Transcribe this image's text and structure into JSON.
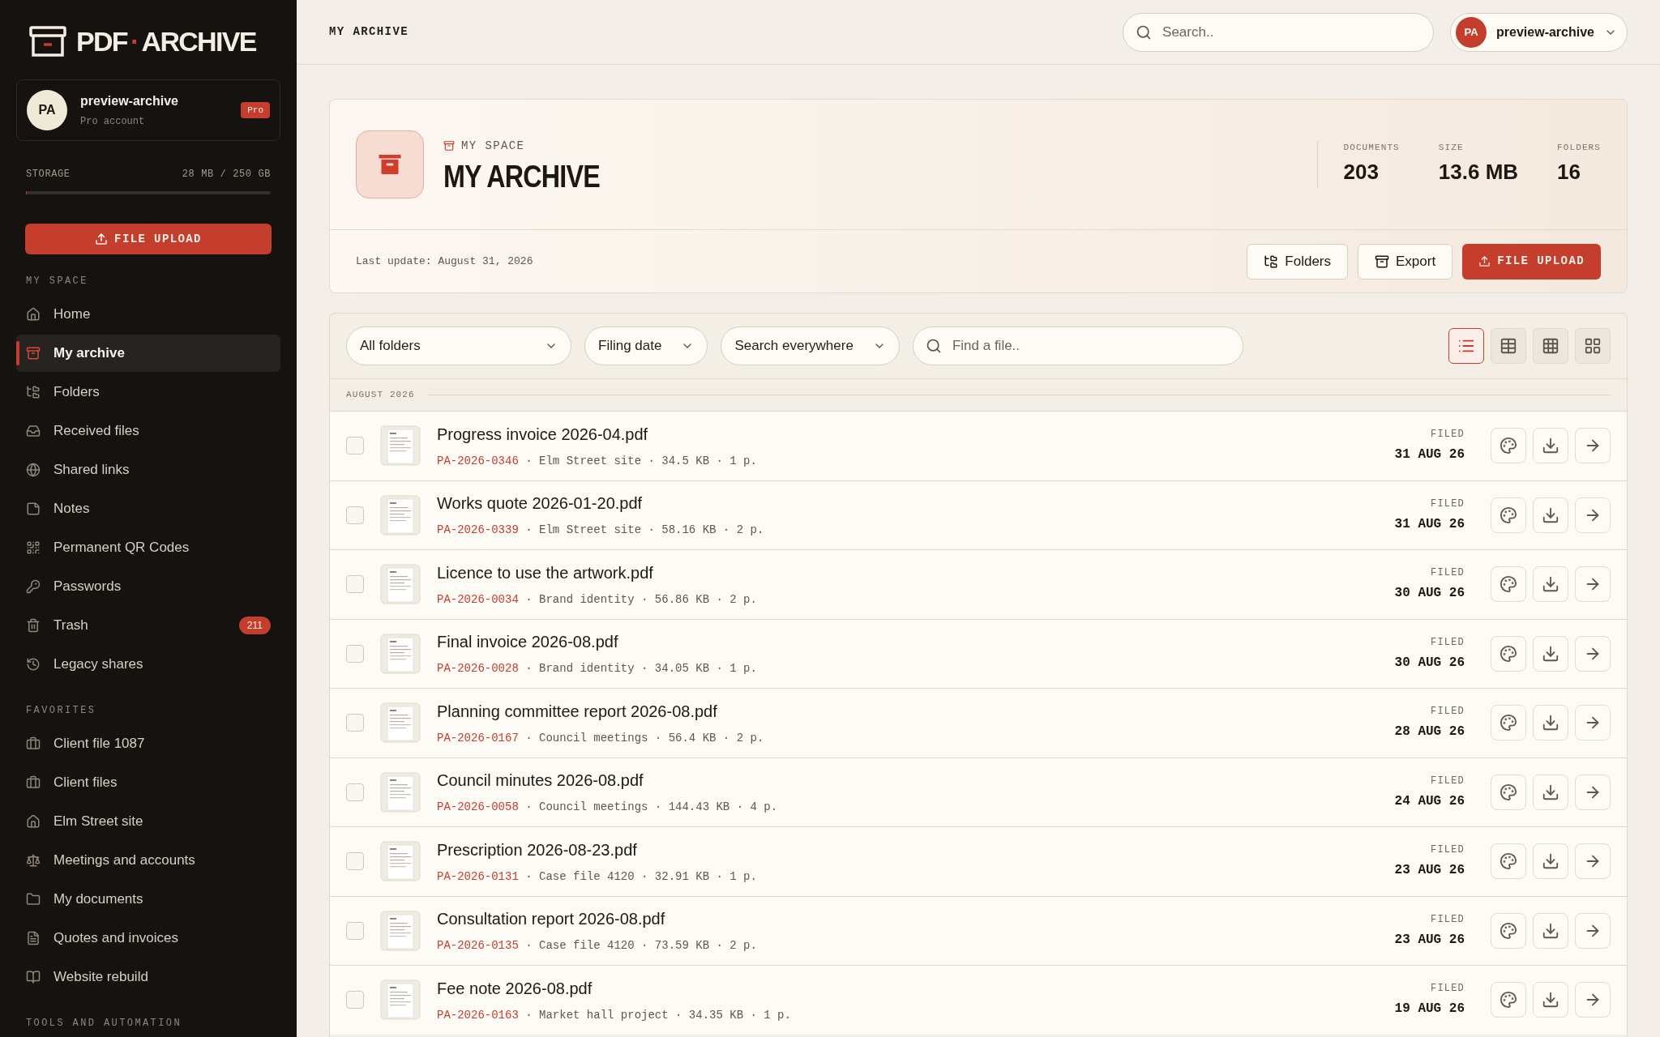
{
  "sidebar": {
    "logo": {
      "left": "PDF",
      "dot": "·",
      "right": "ARCHIVE"
    },
    "account": {
      "initials": "PA",
      "name": "preview-archive",
      "plan": "Pro account",
      "badge": "Pro"
    },
    "storage": {
      "label": "STORAGE",
      "reading": "28 MB / 250 GB",
      "level": 0.001
    },
    "upload_button": "FILE UPLOAD",
    "sections": [
      {
        "title": "MY SPACE",
        "items": [
          {
            "label": "Home",
            "selected": false
          },
          {
            "label": "My archive",
            "selected": true
          },
          {
            "label": "Folders",
            "selected": false
          },
          {
            "label": "Received files",
            "selected": false
          },
          {
            "label": "Shared links",
            "selected": false
          },
          {
            "label": "Notes",
            "selected": false
          },
          {
            "label": "Permanent QR Codes",
            "selected": false
          },
          {
            "label": "Passwords",
            "selected": false
          },
          {
            "label": "Trash",
            "selected": false,
            "count": "211"
          },
          {
            "label": "Legacy shares",
            "selected": false
          }
        ]
      },
      {
        "title": "FAVORITES",
        "items": [
          {
            "label": "Client file 1087",
            "selected": false
          },
          {
            "label": "Client files",
            "selected": false
          },
          {
            "label": "Elm Street site",
            "selected": false
          },
          {
            "label": "Meetings and accounts",
            "selected": false
          },
          {
            "label": "My documents",
            "selected": false
          },
          {
            "label": "Quotes and invoices",
            "selected": false
          },
          {
            "label": "Website rebuild",
            "selected": false
          }
        ]
      },
      {
        "title": "TOOLS AND AUTOMATION"
      }
    ]
  },
  "topbar": {
    "title": "MY ARCHIVE",
    "search": {
      "placeholder": "Search.."
    },
    "user": {
      "initials": "PA",
      "name": "preview-archive"
    }
  },
  "header_card": {
    "eyebrow": "MY SPACE",
    "title": "MY ARCHIVE",
    "stats": [
      {
        "label": "DOCUMENTS",
        "value": "203"
      },
      {
        "label": "SIZE",
        "value": "13.6 MB"
      },
      {
        "label": "FOLDERS",
        "value": "16"
      }
    ],
    "last_update": "Last update: August 31, 2026",
    "buttons": [
      {
        "kind": "folders",
        "label": "Folders"
      },
      {
        "kind": "export",
        "label": "Export"
      },
      {
        "kind": "upload",
        "label": "FILE UPLOAD"
      }
    ]
  },
  "filters": {
    "dropdowns": [
      "All folders",
      "Filing date",
      "Search everywhere"
    ],
    "search": {
      "placeholder": "Find a file.."
    },
    "views": [
      {
        "kind": "list",
        "selected": true
      },
      {
        "kind": "table",
        "selected": false
      },
      {
        "kind": "grid",
        "selected": false
      },
      {
        "kind": "tiles",
        "selected": false
      }
    ]
  },
  "group": "AUGUST 2026",
  "files": [
    {
      "title": "Progress invoice 2026-04.pdf",
      "ref": "PA-2026-0346",
      "meta": " · Elm Street site · 34.5 KB · 1 p.",
      "filed": "FILED",
      "date": "31 AUG 26",
      "checked": false
    },
    {
      "title": "Works quote 2026-01-20.pdf",
      "ref": "PA-2026-0339",
      "meta": " · Elm Street site · 58.16 KB · 2 p.",
      "filed": "FILED",
      "date": "31 AUG 26",
      "checked": false
    },
    {
      "title": "Licence to use the artwork.pdf",
      "ref": "PA-2026-0034",
      "meta": " · Brand identity · 56.86 KB · 2 p.",
      "filed": "FILED",
      "date": "30 AUG 26",
      "checked": false
    },
    {
      "title": "Final invoice 2026-08.pdf",
      "ref": "PA-2026-0028",
      "meta": " · Brand identity · 34.05 KB · 1 p.",
      "filed": "FILED",
      "date": "30 AUG 26",
      "checked": false
    },
    {
      "title": "Planning committee report 2026-08.pdf",
      "ref": "PA-2026-0167",
      "meta": " · Council meetings · 56.4 KB · 2 p.",
      "filed": "FILED",
      "date": "28 AUG 26",
      "checked": false
    },
    {
      "title": "Council minutes 2026-08.pdf",
      "ref": "PA-2026-0058",
      "meta": " · Council meetings · 144.43 KB · 4 p.",
      "filed": "FILED",
      "date": "24 AUG 26",
      "checked": false
    },
    {
      "title": "Prescription 2026-08-23.pdf",
      "ref": "PA-2026-0131",
      "meta": " · Case file 4120 · 32.91 KB · 1 p.",
      "filed": "FILED",
      "date": "23 AUG 26",
      "checked": false
    },
    {
      "title": "Consultation report 2026-08.pdf",
      "ref": "PA-2026-0135",
      "meta": " · Case file 4120 · 73.59 KB · 2 p.",
      "filed": "FILED",
      "date": "23 AUG 26",
      "checked": false
    },
    {
      "title": "Fee note 2026-08.pdf",
      "ref": "PA-2026-0163",
      "meta": " · Market hall project · 34.35 KB · 1 p.",
      "filed": "FILED",
      "date": "19 AUG 26",
      "checked": false
    }
  ]
}
